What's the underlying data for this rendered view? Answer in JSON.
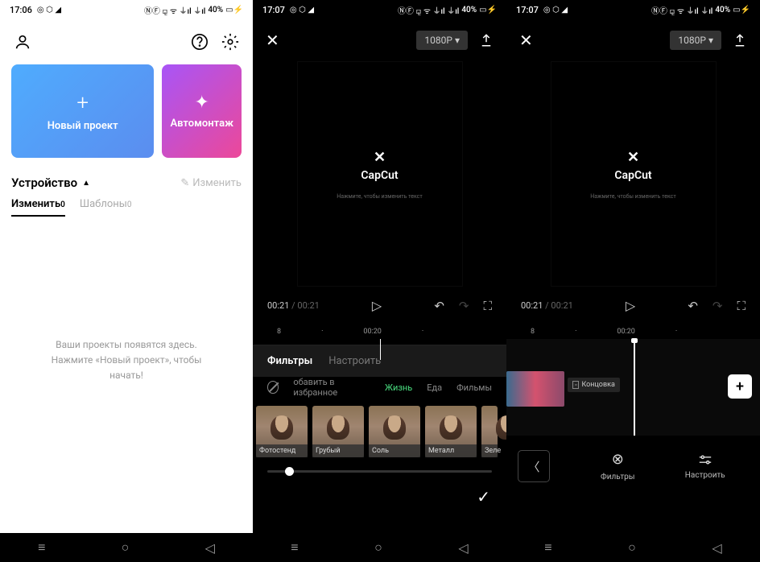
{
  "s1": {
    "status": {
      "time": "17:06",
      "battery": "40%"
    },
    "cards": {
      "newProject": "Новый проект",
      "autoMontage": "Автомонтаж"
    },
    "device": {
      "label": "Устройство",
      "edit": "Изменить"
    },
    "tabs": {
      "edit": "Изменить",
      "editCount": "0",
      "templates": "Шаблоны",
      "templatesCount": "0"
    },
    "empty": "Ваши проекты появятся здесь.\nНажмите «Новый проект», чтобы\nначать!"
  },
  "s2": {
    "status": {
      "time": "17:07",
      "battery": "40%"
    },
    "resolution": "1080P",
    "logo": "CapCut",
    "logoSub": "Нажмите, чтобы изменить текст",
    "time": {
      "current": "00:21",
      "total": "00:21"
    },
    "ruler": {
      "t1": "8",
      "t2": "00:20"
    },
    "filterTabs": {
      "filters": "Фильтры",
      "adjust": "Настроить"
    },
    "cats": {
      "fav": "обавить в избранное",
      "life": "Жизнь",
      "food": "Еда",
      "movies": "Фильмы"
    },
    "thumbs": [
      "Фотостенд",
      "Грубый",
      "Соль",
      "Металл",
      "Зеле"
    ]
  },
  "s3": {
    "status": {
      "time": "17:07",
      "battery": "40%"
    },
    "resolution": "1080P",
    "logo": "CapCut",
    "logoSub": "Нажмите, чтобы изменить текст",
    "time": {
      "current": "00:21",
      "total": "00:21"
    },
    "ruler": {
      "t1": "8",
      "t2": "00:20"
    },
    "ending": "Концовка",
    "tools": {
      "filters": "Фильтры",
      "adjust": "Настроить"
    }
  }
}
